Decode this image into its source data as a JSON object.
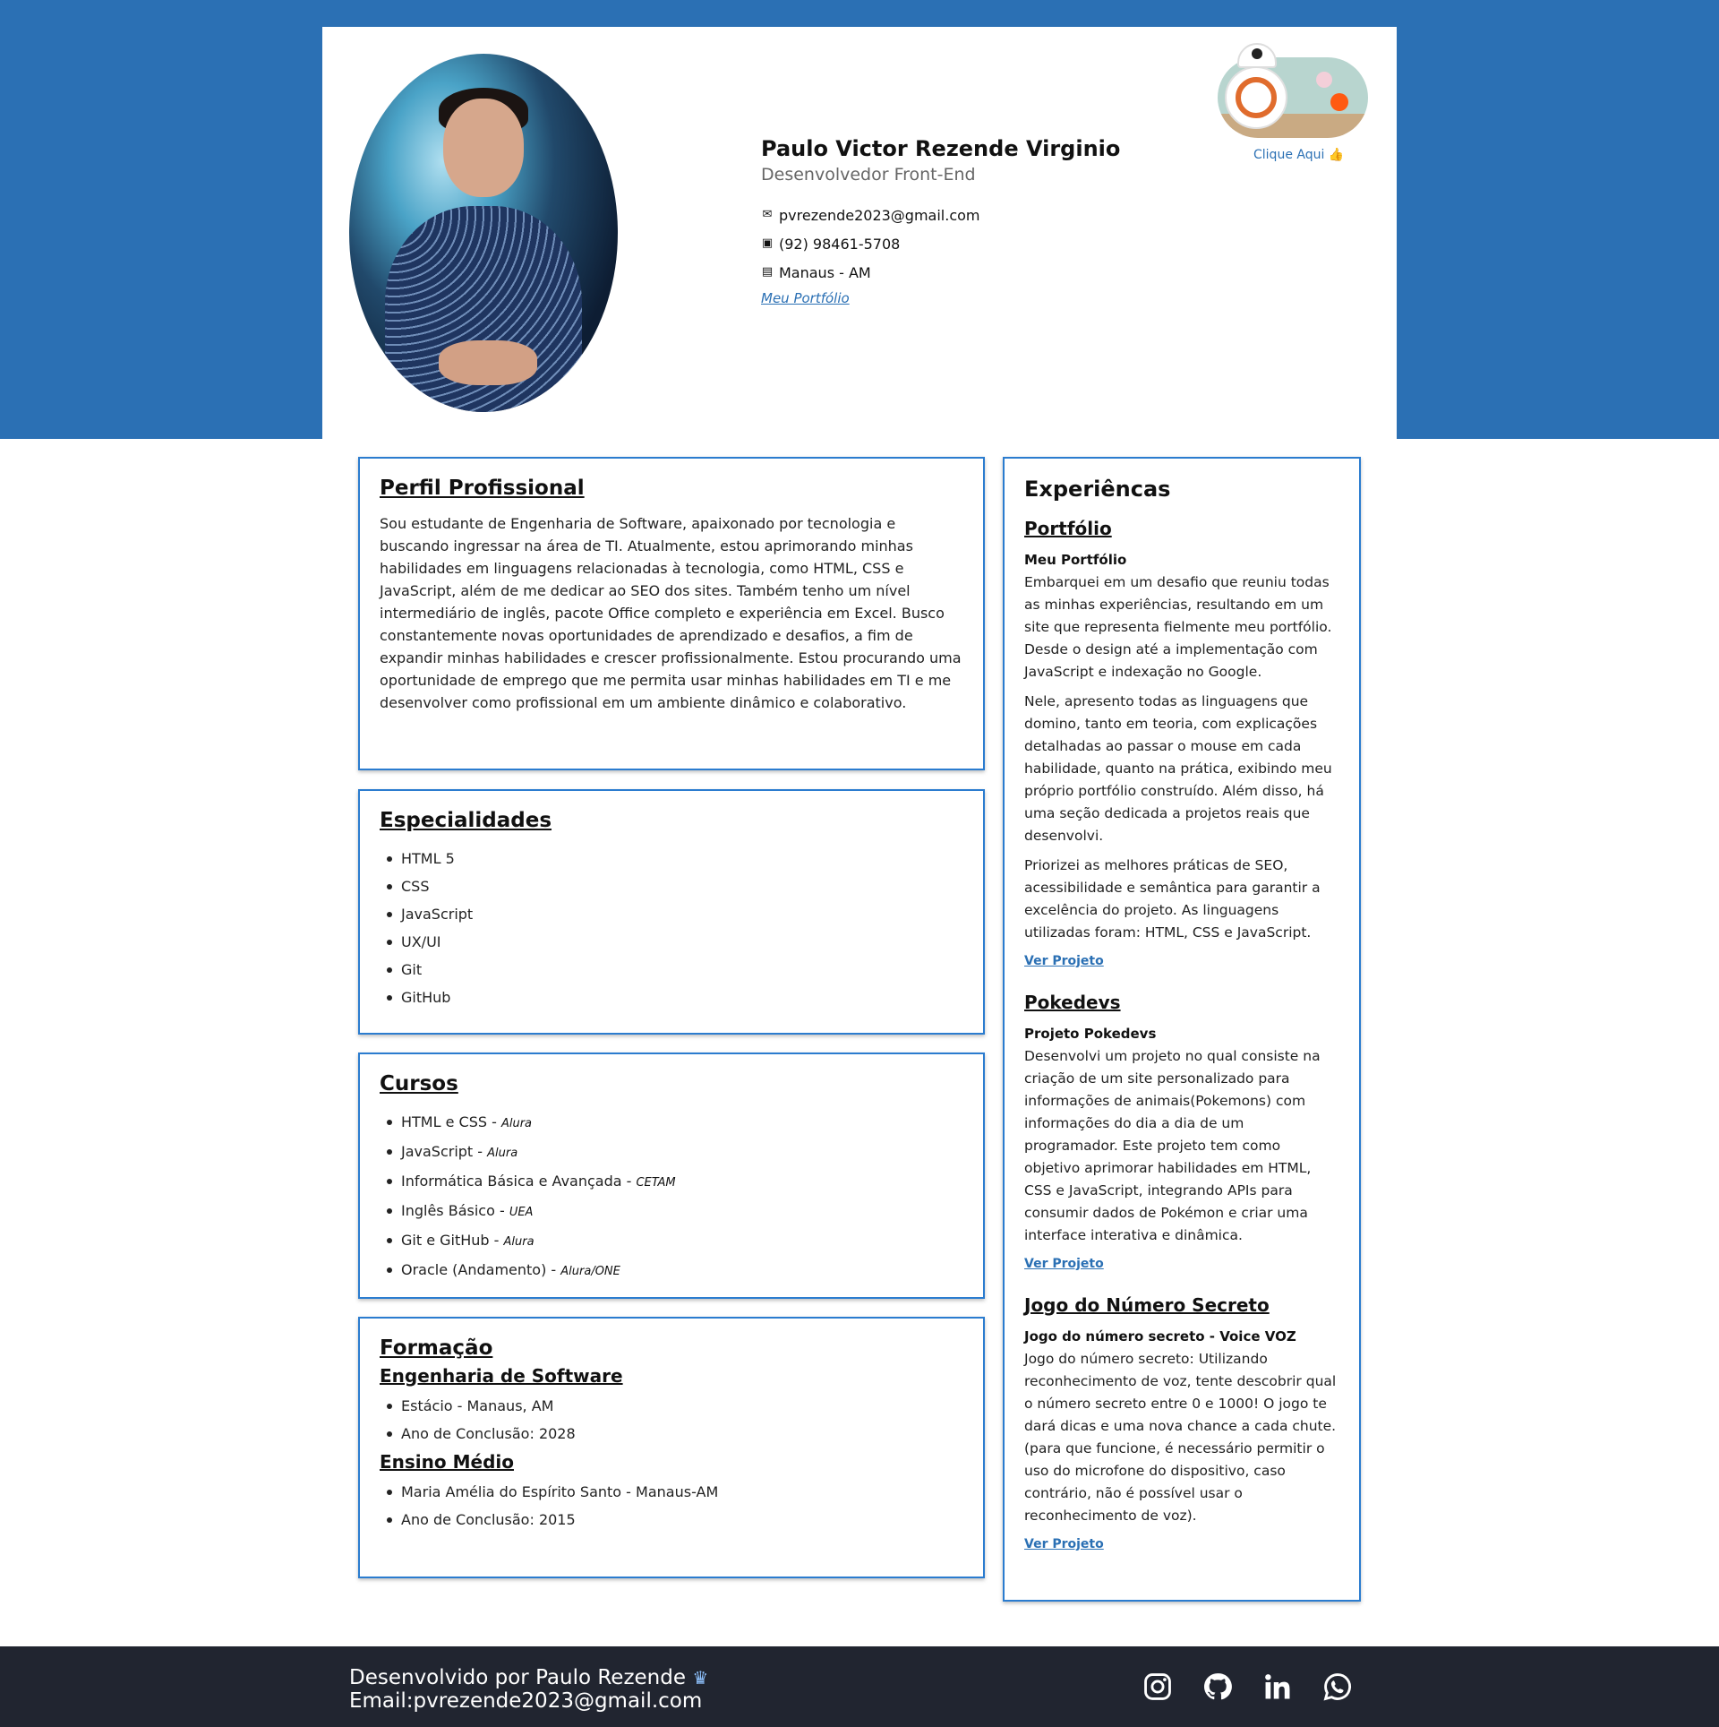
{
  "header": {
    "name": "Paulo Victor Rezende Virginio",
    "role": "Desenvolvedor Front-End",
    "contacts": {
      "email": "pvrezende2023@gmail.com",
      "phone": "(92) 98461-5708",
      "location": "Manaus - AM"
    },
    "portfolio_link": "Meu Portfólio",
    "toggle_label": "Clique Aqui 👍"
  },
  "perfil": {
    "title": "Perfil Profissional",
    "text": "Sou estudante de Engenharia de Software, apaixonado por tecnologia e buscando ingressar na área de TI. Atualmente, estou aprimorando minhas habilidades em linguagens relacionadas à tecnologia, como HTML, CSS e JavaScript, além de me dedicar ao SEO dos sites. Também tenho um nível intermediário de inglês, pacote Office completo e experiência em Excel. Busco constantemente novas oportunidades de aprendizado e desafios, a fim de expandir minhas habilidades e crescer profissionalmente. Estou procurando uma oportunidade de emprego que me permita usar minhas habilidades em TI e me desenvolver como profissional em um ambiente dinâmico e colaborativo."
  },
  "especialidades": {
    "title": "Especialidades",
    "items": [
      "HTML 5",
      "CSS",
      "JavaScript",
      "UX/UI",
      "Git",
      "GitHub"
    ]
  },
  "cursos": {
    "title": "Cursos",
    "items": [
      {
        "name": "HTML e CSS - ",
        "school": "Alura"
      },
      {
        "name": "JavaScript - ",
        "school": "Alura"
      },
      {
        "name": "Informática Básica e Avançada - ",
        "school": "CETAM"
      },
      {
        "name": "Inglês Básico - ",
        "school": "UEA"
      },
      {
        "name": "Git e GitHub - ",
        "school": "Alura"
      },
      {
        "name": "Oracle (Andamento) - ",
        "school": "Alura/ONE"
      }
    ]
  },
  "formacao": {
    "title": "Formação",
    "groups": [
      {
        "title": "Engenharia de Software",
        "items": [
          "Estácio - Manaus, AM",
          "Ano de Conclusão: 2028"
        ]
      },
      {
        "title": "Ensino Médio",
        "items": [
          "Maria Amélia do Espírito Santo - Manaus-AM",
          "Ano de Conclusão: 2015"
        ]
      }
    ]
  },
  "experiencias": {
    "title": "Experiêncas",
    "items": [
      {
        "title": "Portfólio",
        "subtitle": "Meu Portfólio",
        "paragraphs": [
          "Embarquei em um desafio que reuniu todas as minhas experiências, resultando em um site que representa fielmente meu portfólio. Desde o design até a implementação com JavaScript e indexação no Google.",
          "Nele, apresento todas as linguagens que domino, tanto em teoria, com explicações detalhadas ao passar o mouse em cada habilidade, quanto na prática, exibindo meu próprio portfólio construído. Além disso, há uma seção dedicada a projetos reais que desenvolvi.",
          "Priorizei as melhores práticas de SEO, acessibilidade e semântica para garantir a excelência do projeto. As linguagens utilizadas foram: HTML, CSS e JavaScript."
        ],
        "link": "Ver Projeto"
      },
      {
        "title": "Pokedevs",
        "subtitle": "Projeto Pokedevs",
        "paragraphs": [
          "Desenvolvi um projeto no qual consiste na criação de um site personalizado para informações de animais(Pokemons) com informações do dia a dia de um programador. Este projeto tem como objetivo aprimorar habilidades em HTML, CSS e JavaScript, integrando APIs para consumir dados de Pokémon e criar uma interface interativa e dinâmica."
        ],
        "link": "Ver Projeto"
      },
      {
        "title": "Jogo do Número Secreto",
        "subtitle": "Jogo do número secreto - Voice VOZ",
        "paragraphs": [
          "Jogo do número secreto: Utilizando reconhecimento de voz, tente descobrir qual o número secreto entre 0 e 1000! O jogo te dará dicas e uma nova chance a cada chute. (para que funcione, é necessário permitir o uso do microfone do dispositivo, caso contrário, não é possível usar o reconhecimento de voz)."
        ],
        "link": "Ver Projeto"
      }
    ]
  },
  "footer": {
    "credit": "Desenvolvido por Paulo Rezende",
    "crown_icon": "♛",
    "email": "Email:pvrezende2023@gmail.com",
    "social": [
      "instagram-icon",
      "github-icon",
      "linkedin-icon",
      "whatsapp-icon"
    ]
  },
  "colors": {
    "brand_blue": "#2b70b4",
    "box_border": "#2b7ccf",
    "footer_bg": "#212530"
  }
}
